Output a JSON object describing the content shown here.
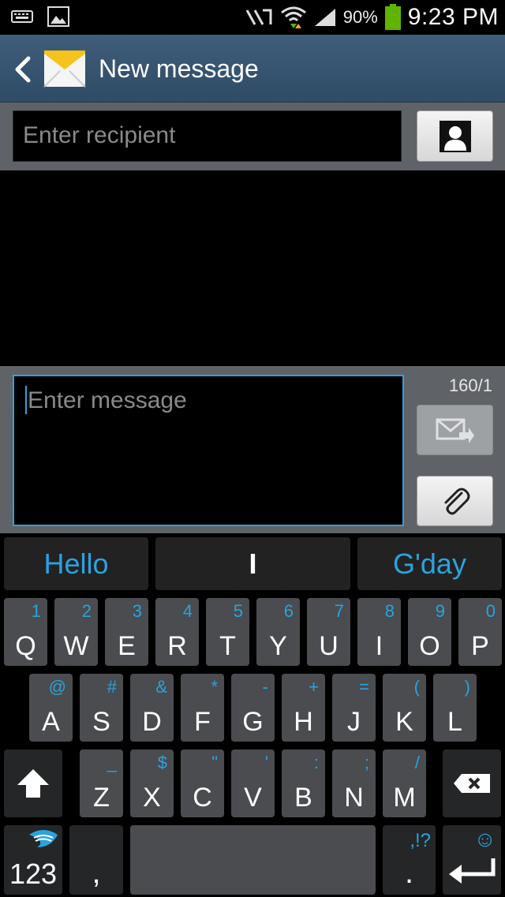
{
  "status_bar": {
    "battery_percent": "90%",
    "time": "9:23 PM",
    "icons": [
      "keyboard-icon",
      "gallery-icon",
      "nfc-icon",
      "wifi-icon",
      "signal-icon",
      "battery-icon"
    ],
    "battery_color": "#5fb400"
  },
  "header": {
    "title": "New message",
    "icons": [
      "back-arrow-icon",
      "envelope-icon"
    ]
  },
  "recipient": {
    "placeholder": "Enter recipient"
  },
  "compose": {
    "placeholder": "Enter message",
    "counter": "160/1",
    "accent": "#2aa3de"
  },
  "keyboard": {
    "suggestions": [
      "Hello",
      "I",
      "G'day"
    ],
    "row1": [
      {
        "main": "Q",
        "alt": "1"
      },
      {
        "main": "W",
        "alt": "2"
      },
      {
        "main": "E",
        "alt": "3"
      },
      {
        "main": "R",
        "alt": "4"
      },
      {
        "main": "T",
        "alt": "5"
      },
      {
        "main": "Y",
        "alt": "6"
      },
      {
        "main": "U",
        "alt": "7"
      },
      {
        "main": "I",
        "alt": "8"
      },
      {
        "main": "O",
        "alt": "9"
      },
      {
        "main": "P",
        "alt": "0"
      }
    ],
    "row2": [
      {
        "main": "A",
        "alt": "@"
      },
      {
        "main": "S",
        "alt": "#"
      },
      {
        "main": "D",
        "alt": "&"
      },
      {
        "main": "F",
        "alt": "*"
      },
      {
        "main": "G",
        "alt": "-"
      },
      {
        "main": "H",
        "alt": "+"
      },
      {
        "main": "J",
        "alt": "="
      },
      {
        "main": "K",
        "alt": "("
      },
      {
        "main": "L",
        "alt": ")"
      }
    ],
    "row3": [
      {
        "main": "Z",
        "alt": "_"
      },
      {
        "main": "X",
        "alt": "$"
      },
      {
        "main": "C",
        "alt": "\""
      },
      {
        "main": "V",
        "alt": "'"
      },
      {
        "main": "B",
        "alt": ":"
      },
      {
        "main": "N",
        "alt": ";"
      },
      {
        "main": "M",
        "alt": "/"
      }
    ],
    "numbers_label": "123",
    "comma_label": ",",
    "period_label": ".",
    "punct_alt": ",!?",
    "emoji_glyph": "☺"
  }
}
